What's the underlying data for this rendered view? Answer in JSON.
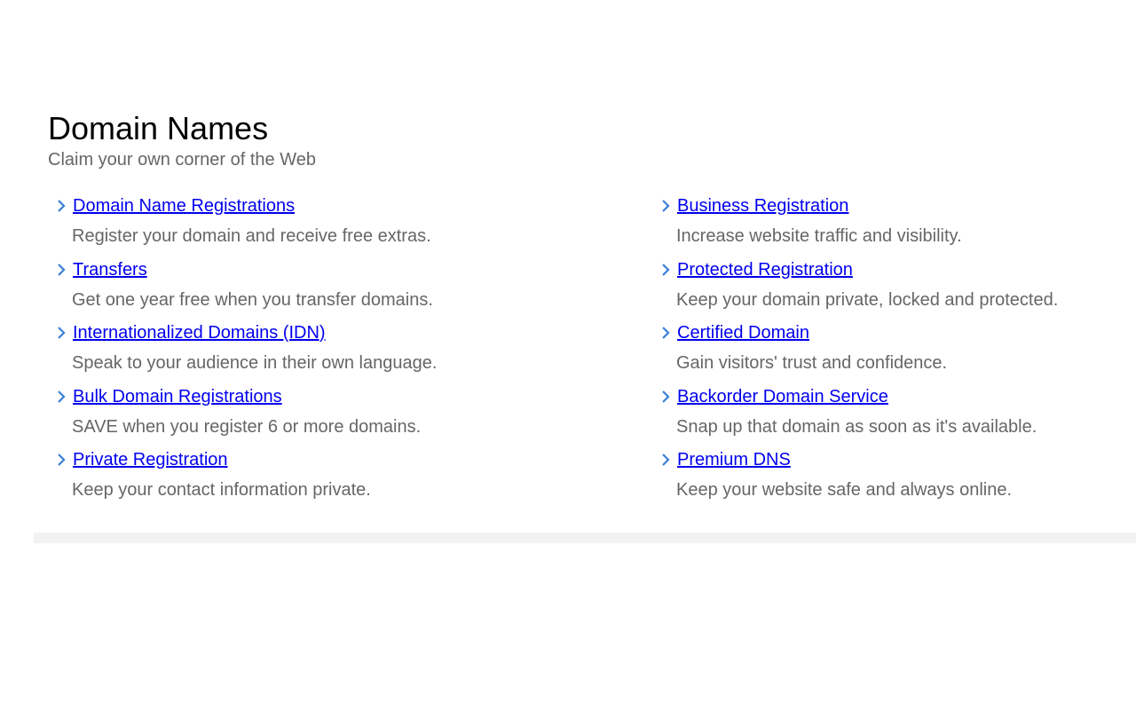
{
  "header": {
    "title": "Domain Names",
    "subtitle": "Claim your own corner of the Web"
  },
  "colors": {
    "link": "#0000ee",
    "chevron": "#3a7fd8",
    "desc": "#666666"
  },
  "left_items": [
    {
      "label": "Domain Name Registrations",
      "desc": "Register your domain and receive free extras."
    },
    {
      "label": "Transfers",
      "desc": "Get one year free when you transfer domains."
    },
    {
      "label": "Internationalized Domains (IDN)",
      "desc": "Speak to your audience in their own language."
    },
    {
      "label": "Bulk Domain Registrations",
      "desc": "SAVE when you register 6 or more domains."
    },
    {
      "label": "Private Registration",
      "desc": "Keep your contact information private."
    }
  ],
  "right_items": [
    {
      "label": "Business Registration",
      "desc": "Increase website traffic and visibility."
    },
    {
      "label": "Protected Registration",
      "desc": "Keep your domain private, locked and protected."
    },
    {
      "label": "Certified Domain",
      "desc": "Gain visitors' trust and confidence."
    },
    {
      "label": "Backorder Domain Service",
      "desc": "Snap up that domain as soon as it's available."
    },
    {
      "label": "Premium DNS",
      "desc": "Keep your website safe and always online."
    }
  ]
}
